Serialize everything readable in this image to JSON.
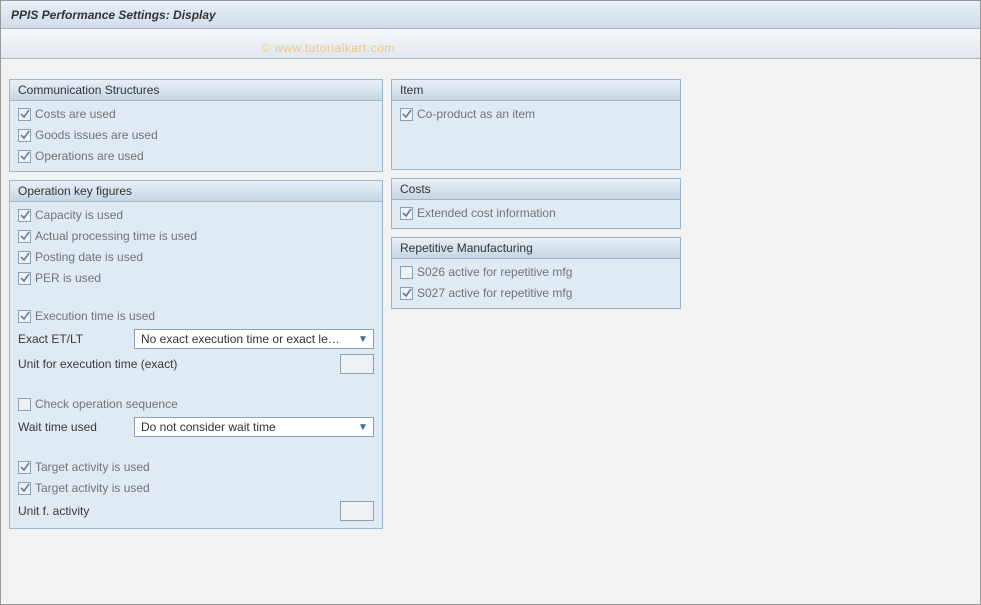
{
  "title": "PPIS Performance Settings: Display",
  "watermark": "© www.tutorialkart.com",
  "groups": {
    "comm": {
      "title": "Communication Structures",
      "costs_used": "Costs are used",
      "goods_issues_used": "Goods issues are used",
      "operations_used": "Operations are used"
    },
    "item": {
      "title": "Item",
      "coproduct": "Co-product as an item"
    },
    "opkey": {
      "title": "Operation key figures",
      "capacity": "Capacity is used",
      "actual_proc": "Actual processing time is used",
      "posting_date": "Posting date is used",
      "per_used": "PER is used",
      "exec_time": "Execution time is used",
      "exact_etlt_label": "Exact ET/LT",
      "exact_etlt_value": "No exact execution time or exact le…",
      "unit_exec_label": "Unit for execution time (exact)",
      "check_seq": "Check operation sequence",
      "wait_label": "Wait time used",
      "wait_value": "Do not consider wait time",
      "target_act1": "Target activity is used",
      "target_act2": "Target activity is used",
      "unit_act_label": "Unit f. activity"
    },
    "costs": {
      "title": "Costs",
      "ext_cost": "Extended cost information"
    },
    "repmfg": {
      "title": "Repetitive Manufacturing",
      "s026": "S026 active for repetitive mfg",
      "s027": "S027 active for repetitive mfg"
    }
  }
}
